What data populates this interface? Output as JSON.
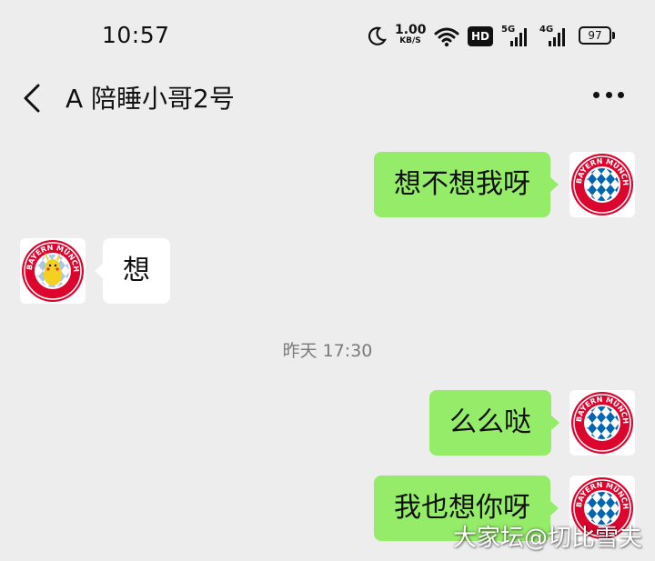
{
  "status_bar": {
    "time": "10:57",
    "net_speed_value": "1.00",
    "net_speed_unit": "KB/S",
    "hd_label": "HD",
    "signal_1": "5G",
    "signal_2": "4G",
    "battery": "97",
    "icons": [
      "moon-icon",
      "wifi-icon",
      "battery-icon"
    ]
  },
  "nav": {
    "back_icon": "chevron-left-icon",
    "title": "A 陪睡小哥2号",
    "more_icon": "more-dots-icon"
  },
  "messages": [
    {
      "side": "out",
      "text": "想不想我呀",
      "avatar": "fc-bayern-logo"
    },
    {
      "side": "in",
      "text": "想",
      "avatar": "fc-bayern-pikachu-logo"
    },
    {
      "side": "out",
      "text": "么么哒",
      "avatar": "fc-bayern-logo"
    },
    {
      "side": "out",
      "text": "我也想你呀",
      "avatar": "fc-bayern-logo"
    }
  ],
  "timestamp": "昨天 17:30",
  "logo_text": "FC BAYERN MÜNCHEN",
  "watermark": "大家坛@切比雪夫",
  "colors": {
    "background": "#ededed",
    "outgoing_bubble": "#95ec69",
    "incoming_bubble": "#ffffff",
    "logo_red": "#dc052d",
    "logo_blue": "#0066b2"
  }
}
